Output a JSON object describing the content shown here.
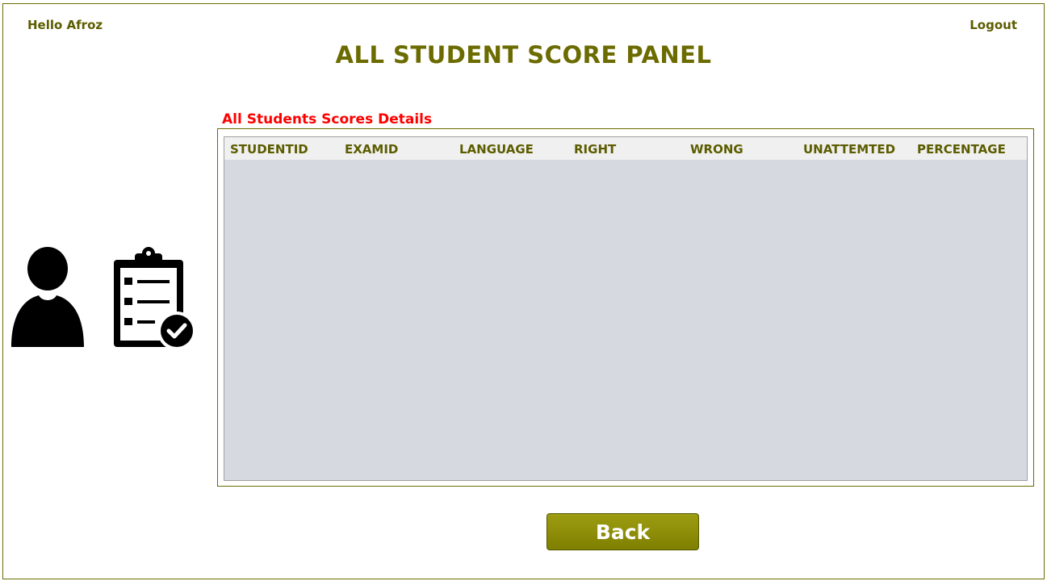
{
  "header": {
    "greeting": "Hello Afroz",
    "logout_label": "Logout",
    "title": "ALL STUDENT SCORE PANEL"
  },
  "section": {
    "label": "All Students Scores Details"
  },
  "table": {
    "columns": [
      "STUDENTID",
      "EXAMID",
      "LANGUAGE",
      "RIGHT",
      "WRONG",
      "UNATTEMTED",
      "PERCENTAGE"
    ],
    "rows": []
  },
  "icons": {
    "user": "user-silhouette-icon",
    "clipboard": "clipboard-checklist-icon"
  },
  "colors": {
    "accent": "#6b6b00",
    "section_label": "#ff0000",
    "table_body": "#d6d9e0",
    "button": "#8c8c06"
  },
  "actions": {
    "back_label": "Back"
  }
}
